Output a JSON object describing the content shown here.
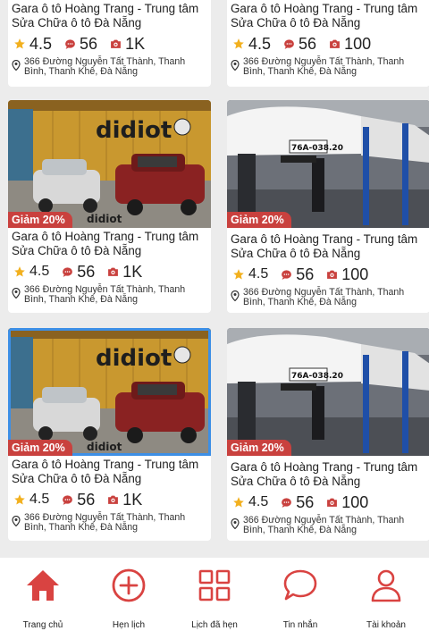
{
  "cards": [
    {
      "title": "Gara ô tô Hoàng Trang - Trung tâm Sửa Chữa ô tô Đà Nẵng",
      "rating": "4.5",
      "comments": "56",
      "photos": "1K",
      "address": "366 Đường Nguyễn Tất Thành, Thanh Bình, Thanh Khê, Đà Nẵng",
      "badge": "",
      "image": "",
      "selected": false
    },
    {
      "title": "Gara ô tô Hoàng Trang - Trung tâm Sửa Chữa ô tô Đà Nẵng",
      "rating": "4.5",
      "comments": "56",
      "photos": "100",
      "address": "366 Đường Nguyễn Tất Thành, Thanh Bình, Thanh Khê, Đà Nẵng",
      "badge": "",
      "image": "",
      "selected": false
    },
    {
      "title": "Gara ô tô Hoàng Trang - Trung tâm Sửa Chữa ô tô Đà Nẵng",
      "rating": "4.5",
      "comments": "56",
      "photos": "1K",
      "address": "366 Đường Nguyễn Tất Thành, Thanh Bình, Thanh Khê, Đà Nẵng",
      "badge": "Giảm 20%",
      "image": "showroom",
      "selected": false
    },
    {
      "title": "Gara ô tô Hoàng Trang - Trung tâm Sửa Chữa ô tô Đà Nẵng",
      "rating": "4.5",
      "comments": "56",
      "photos": "100",
      "address": "366 Đường Nguyễn Tất Thành, Thanh Bình, Thanh Khê, Đà Nẵng",
      "badge": "Giảm 20%",
      "image": "lift",
      "selected": false
    },
    {
      "title": "Gara ô tô Hoàng Trang - Trung tâm Sửa Chữa ô tô Đà Nẵng",
      "rating": "4.5",
      "comments": "56",
      "photos": "1K",
      "address": "366 Đường Nguyễn Tất Thành, Thanh Bình, Thanh Khê, Đà Nẵng",
      "badge": "Giảm 20%",
      "image": "showroom",
      "selected": true
    },
    {
      "title": "Gara ô tô Hoàng Trang - Trung tâm Sửa Chữa ô tô Đà Nẵng",
      "rating": "4.5",
      "comments": "56",
      "photos": "100",
      "address": "366 Đường Nguyễn Tất Thành, Thanh Bình, Thanh Khê, Đà Nẵng",
      "badge": "Giảm 20%",
      "image": "lift",
      "selected": false
    }
  ],
  "image_text": {
    "logo": "didiot",
    "plate": "76A-038.20"
  },
  "nav": [
    {
      "label": "Trang chủ",
      "icon": "home-icon"
    },
    {
      "label": "Hẹn lịch",
      "icon": "plus-circle-icon"
    },
    {
      "label": "Lịch đã hẹn",
      "icon": "grid-icon"
    },
    {
      "label": "Tin nhắn",
      "icon": "chat-icon"
    },
    {
      "label": "Tài khoản",
      "icon": "user-icon"
    }
  ],
  "colors": {
    "accent": "#c9413e",
    "star": "#f2b01e",
    "selected_border": "#3d8fe6",
    "badge": "#c9413e"
  }
}
